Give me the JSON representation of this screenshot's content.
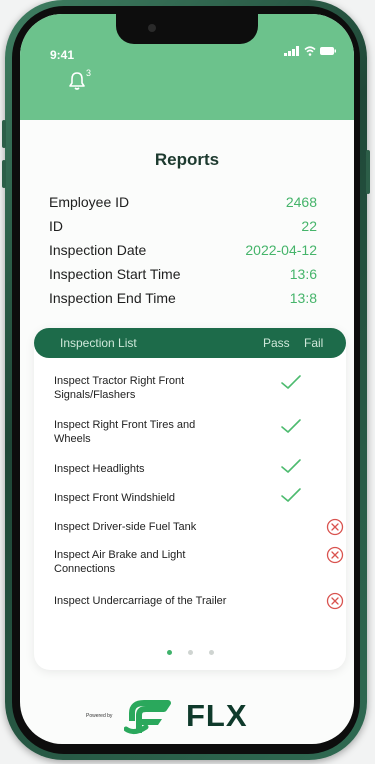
{
  "status_bar": {
    "time": "9:41"
  },
  "notifications": {
    "count": "3"
  },
  "page": {
    "title": "Reports"
  },
  "info": [
    {
      "label": "Employee ID",
      "value": "2468"
    },
    {
      "label": "ID",
      "value": "22"
    },
    {
      "label": "Inspection Date",
      "value": "2022-04-12"
    },
    {
      "label": "Inspection Start Time",
      "value": "13:6"
    },
    {
      "label": "Inspection End Time",
      "value": "13:8"
    }
  ],
  "inspection_list": {
    "header": {
      "name": "Inspection List",
      "pass": "Pass",
      "fail": "Fail"
    },
    "items": [
      {
        "text": "Inspect Tractor Right Front Signals/Flashers",
        "result": "pass"
      },
      {
        "text": "Inspect Right Front Tires and Wheels",
        "result": "pass"
      },
      {
        "text": "Inspect Headlights",
        "result": "pass"
      },
      {
        "text": "Inspect Front Windshield",
        "result": "pass"
      },
      {
        "text": "Inspect Driver-side Fuel Tank",
        "result": "fail"
      },
      {
        "text": "Inspect Air Brake and Light Connections",
        "result": "fail"
      },
      {
        "text": "Inspect Undercarriage of the Trailer",
        "result": "fail"
      }
    ]
  },
  "pagination": {
    "pages": 3,
    "active": 1
  },
  "footer": {
    "powered_by": "Powered by",
    "brand": "FLX"
  },
  "colors": {
    "header_green": "#6cc28c",
    "accent_green": "#45b46a",
    "list_header": "#1d6b4a",
    "fail_red": "#d9534f",
    "brand_dark": "#0f3a2b"
  }
}
